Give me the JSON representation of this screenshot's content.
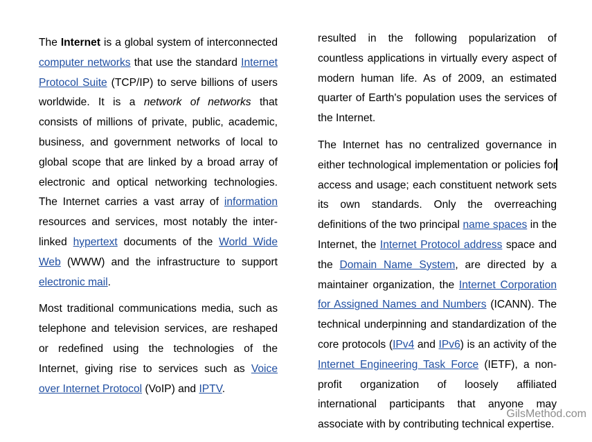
{
  "document": {
    "left_column": {
      "paragraph1": {
        "t1": "The ",
        "bold_term": "Internet",
        "t2": " is a global system of interconnected ",
        "link_computer_networks": "computer networks",
        "t3": " that use the standard ",
        "link_internet_protocol_suite": "Internet Protocol Suite",
        "t4": " (TCP/IP) to serve billions of users worldwide. It is a ",
        "italic_term": "network of networks",
        "t5": " that consists of millions of private, public, academic, business, and government networks of local to global scope that are linked by a broad array of electronic and optical networking technologies. The Internet carries a vast array of ",
        "link_information": "information",
        "t6": " resources and services, most notably the inter-linked ",
        "link_hypertext": "hypertext",
        "t7": " documents of the ",
        "link_world_wide_web": "World Wide Web",
        "t8": " (WWW) and the infrastructure to support ",
        "link_electronic_mail": "electronic mail",
        "t9": "."
      },
      "paragraph2": {
        "t1": "Most traditional communications media, such as telephone and television services, are reshaped or redefined using the technologies of the Internet, giving rise to services such as ",
        "link_voip": "Voice over Internet Protocol",
        "t2": " (VoIP) and ",
        "link_iptv": "IPTV",
        "t3": "."
      }
    },
    "right_column": {
      "paragraph1": {
        "t1": "resulted in the following popularization of countless applications in virtually every aspect of modern human life. As of 2009, an estimated quarter of Earth's population uses the services of the Internet."
      },
      "paragraph2": {
        "t1": "The Internet has no centralized governance in either technological implementation or policies for",
        "t2": " access and usage; each constituent network sets its own standards. Only the overreaching definitions of the two principal ",
        "link_name_spaces": "name spaces",
        "t3": " in the Internet, the ",
        "link_ip_address": "Internet Protocol address",
        "t4": " space and the ",
        "link_dns": "Domain Name System",
        "t5": ", are directed by a maintainer organization, the ",
        "link_icann": "Internet Corporation for Assigned Names and Numbers",
        "t6": " (ICANN). The technical underpinning and standardization of the core protocols (",
        "link_ipv4": "IPv4",
        "t7": " and ",
        "link_ipv6": "IPv6",
        "t8": ") is an activity of the ",
        "link_ietf": "Internet Engineering Task Force",
        "t9": " (IETF), a non-profit organization of loosely affiliated international participants that anyone may associate with by contributing technical expertise."
      }
    }
  },
  "watermark": "GilsMethod.com",
  "colors": {
    "link": "#1f4ea1",
    "text": "#000000",
    "watermark": "#8c8c8c"
  }
}
